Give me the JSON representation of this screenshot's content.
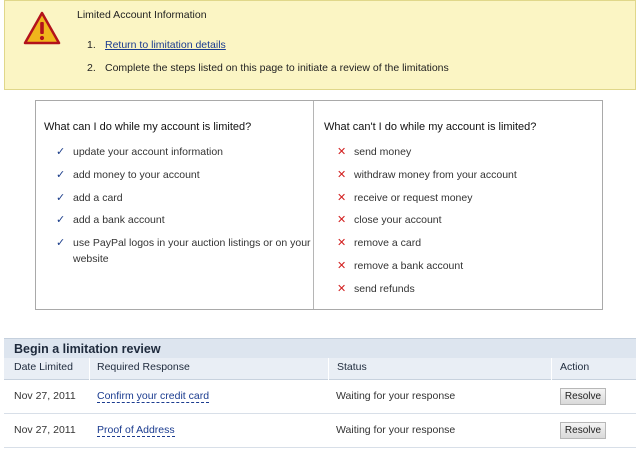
{
  "notice": {
    "title": "Limited Account Information",
    "steps": [
      {
        "num": "1.",
        "text": "Return to limitation details"
      },
      {
        "num": "2.",
        "text": "Complete the steps listed on this page to initiate a review of the limitations"
      }
    ]
  },
  "limits": {
    "can": {
      "heading": "What can I do while my account is limited?",
      "items": [
        "update your account information",
        "add money to your account",
        "add a card",
        "add a bank account",
        "use PayPal logos in your auction listings or on your website"
      ]
    },
    "cant": {
      "heading": "What can't I do while my account is limited?",
      "items": [
        "send money",
        "withdraw money from your account",
        "receive or request money",
        "close your account",
        "remove a card",
        "remove a bank account",
        "send refunds"
      ]
    }
  },
  "review": {
    "title": "Begin a limitation review",
    "columns": [
      "Date Limited",
      "Required Response",
      "Status",
      "Action"
    ],
    "rows": [
      {
        "date": "Nov 27, 2011",
        "response": "Confirm your credit card",
        "status": "Waiting for your response",
        "action": "Resolve"
      },
      {
        "date": "Nov 27, 2011",
        "response": "Proof of Address",
        "status": "Waiting for your response",
        "action": "Resolve"
      }
    ]
  },
  "colors": {
    "accent_link": "#1a3b8f",
    "check": "#1b3d8a",
    "cross": "#d21f1f",
    "notice_bg": "#fbf5c4"
  },
  "icons": {
    "warning": "warning-triangle-icon",
    "check": "checkmark-icon",
    "cross": "cross-icon"
  }
}
